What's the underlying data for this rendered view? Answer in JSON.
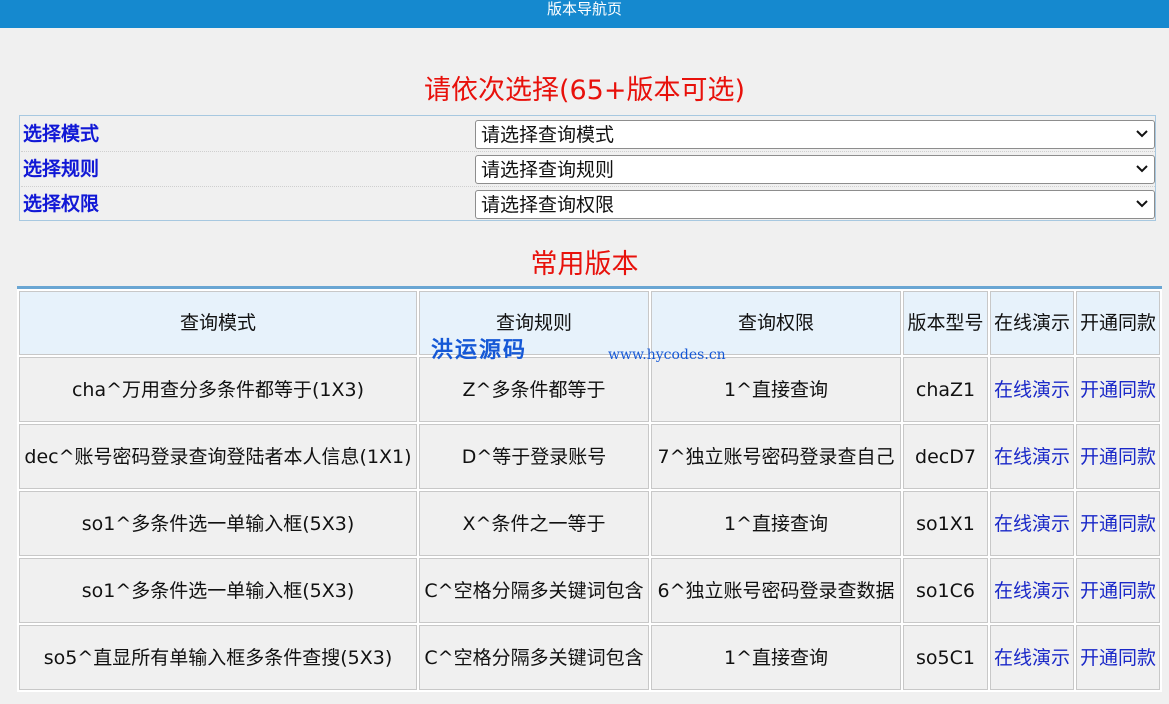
{
  "header": {
    "title": "版本导航页"
  },
  "selection": {
    "title": "请依次选择(65+版本可选)",
    "rows": [
      {
        "label": "选择模式",
        "value": "请选择查询模式"
      },
      {
        "label": "选择规则",
        "value": "请选择查询规则"
      },
      {
        "label": "选择权限",
        "value": "请选择查询权限"
      }
    ]
  },
  "common": {
    "title": "常用版本",
    "headers": [
      "查询模式",
      "查询规则",
      "查询权限",
      "版本型号",
      "在线演示",
      "开通同款"
    ],
    "rows": [
      {
        "mode": "cha^万用查分多条件都等于(1X3)",
        "rule": "Z^多条件都等于",
        "perm": "1^直接查询",
        "model": "chaZ1",
        "demo": "在线演示",
        "open": "开通同款"
      },
      {
        "mode": "dec^账号密码登录查询登陆者本人信息(1X1)",
        "rule": "D^等于登录账号",
        "perm": "7^独立账号密码登录查自己",
        "model": "decD7",
        "demo": "在线演示",
        "open": "开通同款"
      },
      {
        "mode": "so1^多条件选一单输入框(5X3)",
        "rule": "X^条件之一等于",
        "perm": "1^直接查询",
        "model": "so1X1",
        "demo": "在线演示",
        "open": "开通同款"
      },
      {
        "mode": "so1^多条件选一单输入框(5X3)",
        "rule": "C^空格分隔多关键词包含",
        "perm": "6^独立账号密码登录查数据",
        "model": "so1C6",
        "demo": "在线演示",
        "open": "开通同款"
      },
      {
        "mode": "so5^直显所有单输入框多条件查搜(5X3)",
        "rule": "C^空格分隔多关键词包含",
        "perm": "1^直接查询",
        "model": "so5C1",
        "demo": "在线演示",
        "open": "开通同款"
      }
    ]
  },
  "watermark": {
    "text": "洪运源码",
    "url": "www.hycodes.cn"
  },
  "icons": {
    "select_arrow": "chevron-down-icon"
  },
  "colors": {
    "header_bg": "#1589cf",
    "title_red": "#e8110b",
    "label_blue": "#1118d6",
    "link_blue": "#1a28c8"
  }
}
